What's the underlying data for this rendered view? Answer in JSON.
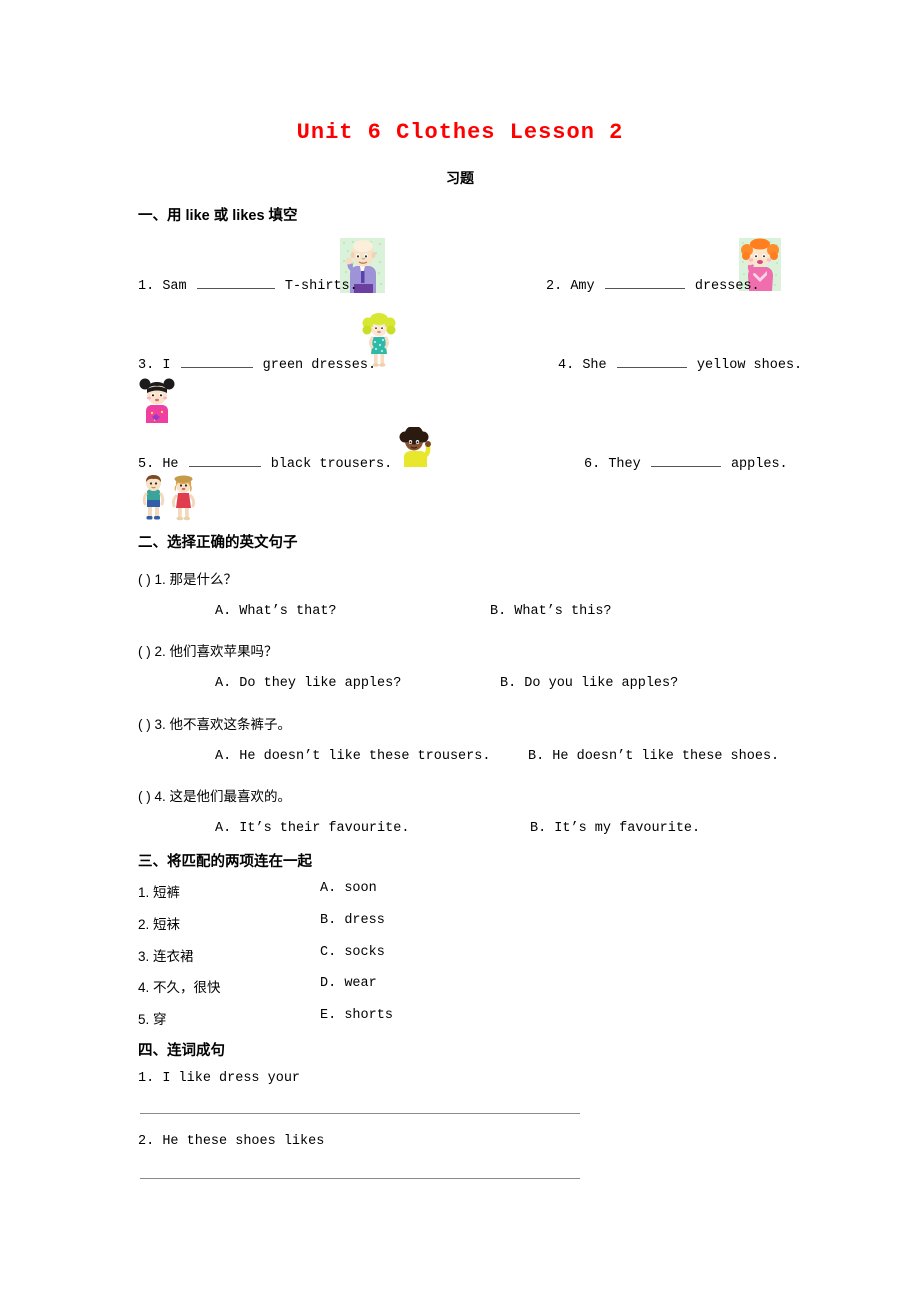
{
  "document": {
    "title": "Unit 6 Clothes Lesson 2",
    "subtitle": "习题"
  },
  "sections": [
    {
      "id": "section-1",
      "heading_prefix": "一、用",
      "heading_word1": "like",
      "heading_mid": "或",
      "heading_word2": "likes",
      "heading_suffix": "填空",
      "heading_full": "一、用 like 或 likes 填空",
      "items": [
        {
          "number": "1.",
          "before": "Sam",
          "after": "T-shirts.",
          "image": "old-man-purple-suit"
        },
        {
          "number": "2.",
          "before": "Amy",
          "after": "dresses.",
          "image": "old-woman-orange-hair"
        },
        {
          "number": "3.",
          "before": "I",
          "after": "green dresses.",
          "image": "girl-green-pigtails-teal-dress"
        },
        {
          "number": "4.",
          "before": "She",
          "after": "yellow shoes.",
          "image": "girl-black-buns-pink-top"
        },
        {
          "number": "5.",
          "before": "He",
          "after": "black trousers.",
          "image": "boy-afro-yellow-shirt"
        },
        {
          "number": "6.",
          "before": "They",
          "after": "apples.",
          "image": "two-children-boy-girl"
        }
      ]
    },
    {
      "id": "section-2",
      "heading_full": "二、选择正确的英文句子",
      "questions": [
        {
          "bracket": "(    )",
          "number": "1.",
          "prompt": "那是什么？",
          "option_a": "A. What’s that?",
          "option_b": "B. What’s this?"
        },
        {
          "bracket": "(    )",
          "number": "2.",
          "prompt": "他们喜欢苹果吗？",
          "option_a": "A. Do they like apples?",
          "option_b": "B. Do you like apples?"
        },
        {
          "bracket": "(    )",
          "number": "3.",
          "prompt": "他不喜欢这条裤子。",
          "option_a": "A. He doesn’t like these trousers.",
          "option_b": "B. He doesn’t like these shoes."
        },
        {
          "bracket": "(    )",
          "number": "4.",
          "prompt": "这是他们最喜欢的。",
          "option_a": "A. It’s their favourite.",
          "option_b": "B. It’s my favourite."
        }
      ]
    },
    {
      "id": "section-3",
      "heading_full": "三、将匹配的两项连在一起",
      "left_column": [
        {
          "number": "1.",
          "text": "短裤"
        },
        {
          "number": "2.",
          "text": "短袜"
        },
        {
          "number": "3.",
          "text": "连衣裙"
        },
        {
          "number": "4.",
          "text": "不久，很快"
        },
        {
          "number": "5.",
          "text": "穿"
        }
      ],
      "right_column": [
        {
          "letter": "A.",
          "text": "soon"
        },
        {
          "letter": "B.",
          "text": "dress"
        },
        {
          "letter": "C.",
          "text": "socks"
        },
        {
          "letter": "D.",
          "text": "wear"
        },
        {
          "letter": "E.",
          "text": "shorts"
        }
      ]
    },
    {
      "id": "section-4",
      "heading_full": "四、连词成句",
      "items": [
        {
          "number": "1.",
          "words": "I  like  dress  your"
        },
        {
          "number": "2.",
          "words": "He  these  shoes  likes"
        }
      ]
    }
  ],
  "colors": {
    "title_red": "#ff0000",
    "text_black": "#000000",
    "rule_gray": "#8a8a8a"
  }
}
